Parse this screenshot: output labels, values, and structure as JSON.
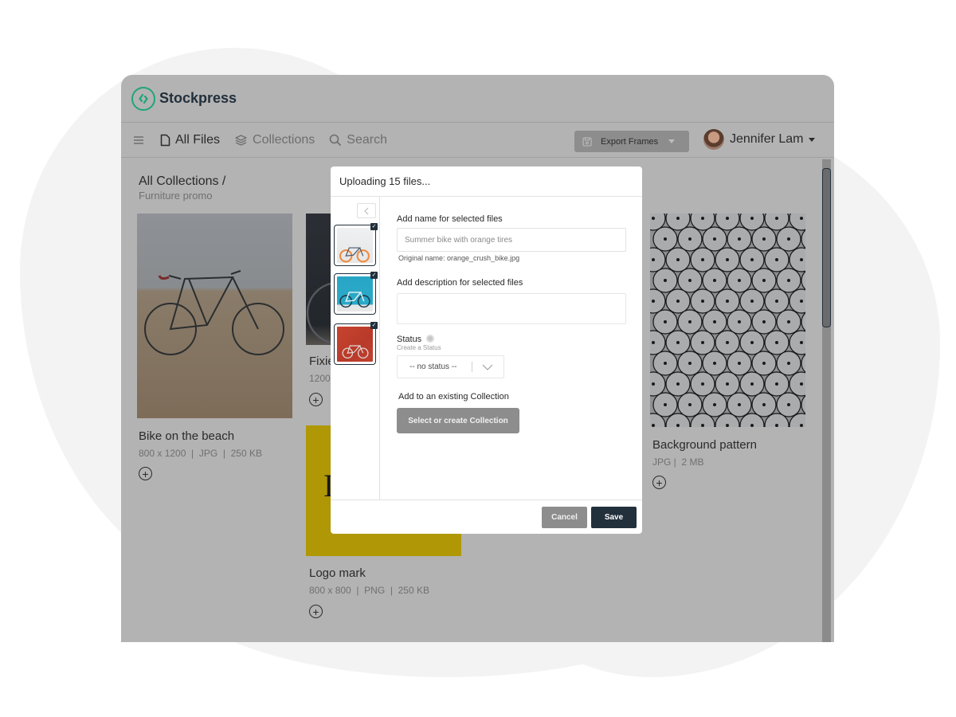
{
  "app": {
    "brand": "Stockpress",
    "brand_color": "#1fa57a"
  },
  "nav": {
    "items": [
      {
        "label": "All Files",
        "icon": "file-icon",
        "active": true
      },
      {
        "label": "Collections",
        "icon": "layers-icon",
        "active": false
      },
      {
        "label": "Search",
        "icon": "search-icon",
        "active": false
      }
    ],
    "export_label": "Export Frames",
    "user_name": "Jennifer Lam"
  },
  "breadcrumb": {
    "root": "All Collections /",
    "current": "Furniture promo"
  },
  "cards": [
    {
      "name": "Bike on the beach",
      "meta": "800 x 1200  |  JPG  |  250 KB"
    },
    {
      "name": "Fixie",
      "meta": "1200"
    },
    {
      "name": "Logo mark",
      "meta": "800 x 800  |  PNG  |  250 KB"
    },
    {
      "name": "Background pattern",
      "meta": "JPG |  2 MB"
    }
  ],
  "modal": {
    "title": "Uploading 15 files...",
    "name_label": "Add name for selected files",
    "name_placeholder": "Summer bike with orange tires",
    "original_name": "Original name: orange_crush_bike.jpg",
    "description_label": "Add description for selected files",
    "description_value": "",
    "status_label": "Status",
    "status_help": "Create a Status",
    "status_value": "-- no status --",
    "collection_label": "Add to an existing Collection",
    "collection_button": "Select or create Collection",
    "cancel": "Cancel",
    "save": "Save",
    "thumbnails": [
      {
        "name": "orange bike on white",
        "selected": true
      },
      {
        "name": "bike on blue wall",
        "selected": true
      },
      {
        "name": "bike on red wall",
        "selected": true
      }
    ]
  },
  "colors": {
    "primary": "#22303c",
    "overlay": "#b3b3b3",
    "secondary_button": "#8d8d8d"
  }
}
